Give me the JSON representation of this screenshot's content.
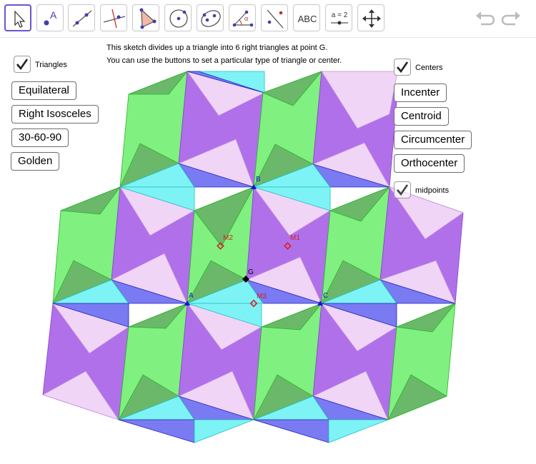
{
  "toolbar": {
    "tools": [
      {
        "icon": "move-arrow-icon"
      },
      {
        "icon": "point-icon",
        "glyph": "A"
      },
      {
        "icon": "line-icon"
      },
      {
        "icon": "perpendicular-icon"
      },
      {
        "icon": "polygon-icon"
      },
      {
        "icon": "circle-icon"
      },
      {
        "icon": "ellipse-icon"
      },
      {
        "icon": "angle-icon",
        "glyph": "α"
      },
      {
        "icon": "reflect-icon"
      },
      {
        "icon": "text-icon",
        "glyph": "ABC"
      },
      {
        "icon": "slider-icon",
        "glyph": "a = 2"
      },
      {
        "icon": "move-view-icon"
      }
    ],
    "undo_icon": "undo-icon",
    "redo_icon": "redo-icon"
  },
  "description": {
    "line1": "This sketch divides up a triangle into 6 right triangles at point G.",
    "line2": "You can use the buttons to set a particular type of triangle or center."
  },
  "left_panel": {
    "triangles_checkbox": {
      "label": "Triangles",
      "checked": true
    },
    "buttons": [
      "Equilateral",
      "Right Isosceles",
      "30-60-90",
      "Golden"
    ]
  },
  "right_panel": {
    "centers_checkbox": {
      "label": "Centers",
      "checked": true
    },
    "buttons": [
      "Incenter",
      "Centroid",
      "Circumcenter",
      "Orthocenter"
    ],
    "midpoints_checkbox": {
      "label": "midpoints",
      "checked": true
    }
  },
  "points": {
    "A": "A",
    "B": "B",
    "C": "C",
    "G": "G",
    "M1": "M1",
    "M2": "M2",
    "M3": "M3"
  },
  "colors": {
    "green": "#80f080",
    "dark_green": "#6bb86b",
    "purple": "#b070ea",
    "light_pink": "#f0d5f6",
    "blue": "#7a7af2",
    "cyan": "#7ef3f5",
    "accent": "#6557d2",
    "point_blue": "#1515d6",
    "midpoint_red": "#d82020"
  }
}
